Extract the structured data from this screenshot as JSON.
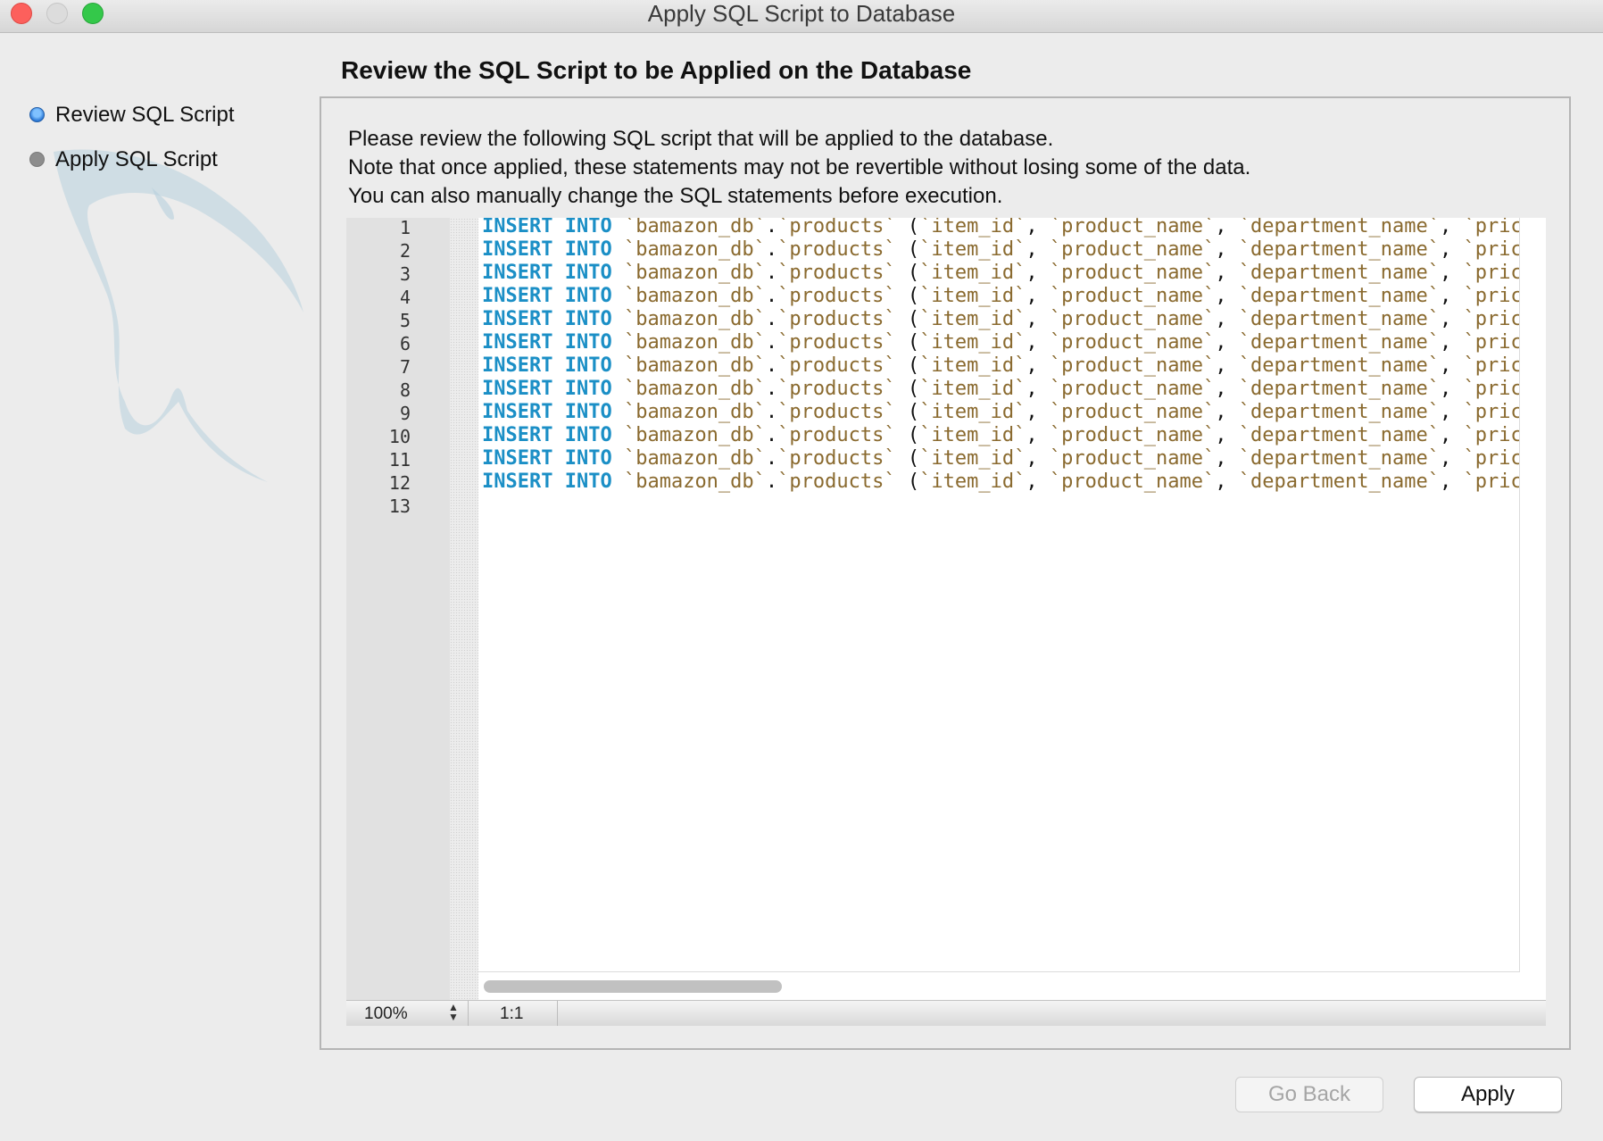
{
  "window": {
    "title": "Apply SQL Script to Database"
  },
  "steps": [
    {
      "label": "Review SQL Script",
      "state": "active"
    },
    {
      "label": "Apply SQL Script",
      "state": "pending"
    }
  ],
  "main": {
    "heading": "Review the SQL Script to be Applied on the Database",
    "description": [
      "Please review the following SQL script that will be applied to the database.",
      "Note that once applied, these statements may not be revertible without losing some of the data.",
      "You can also manually change the SQL statements before execution."
    ]
  },
  "editor": {
    "line_numbers": [
      "1",
      "2",
      "3",
      "4",
      "5",
      "6",
      "7",
      "8",
      "9",
      "10",
      "11",
      "12",
      "13"
    ],
    "code_line": {
      "keyword1": "INSERT",
      "keyword2": "INTO",
      "schema": "`bamazon_db`",
      "dot": ".",
      "table": "`products`",
      "open_paren": "(",
      "col1": "`item_id`",
      "col2": "`product_name`",
      "col3": "`department_name`",
      "col4": "`pric",
      "comma": ","
    },
    "code_line_count": 12
  },
  "statusbar": {
    "zoom": "100%",
    "position": "1:1"
  },
  "buttons": {
    "go_back": "Go Back",
    "apply": "Apply"
  },
  "colors": {
    "keyword": "#1b8fc6",
    "identifier": "#8a6a2f",
    "active_step": "#2b78d6"
  }
}
